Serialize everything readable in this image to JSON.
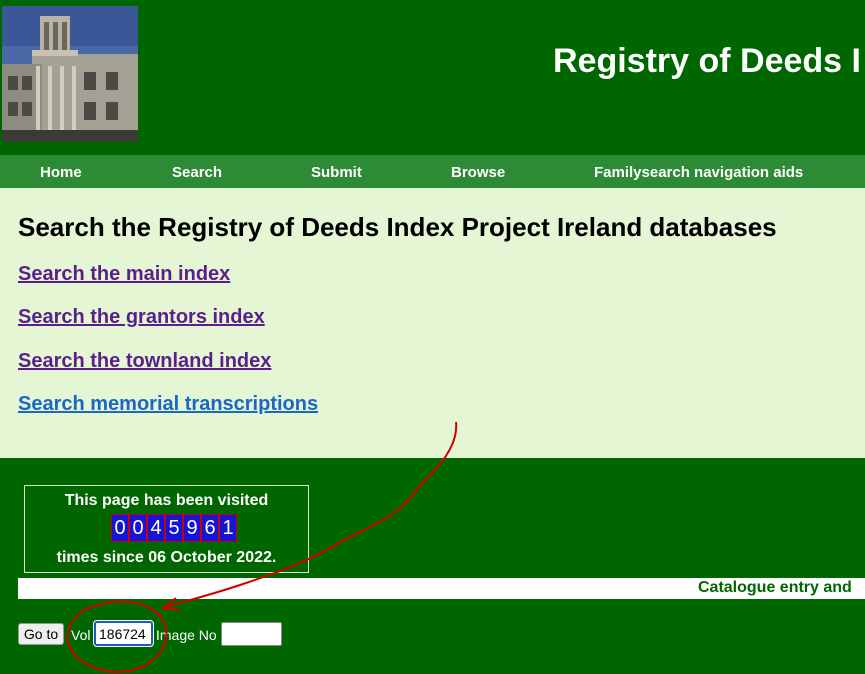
{
  "header": {
    "title": "Registry of Deeds I"
  },
  "nav": {
    "items": [
      {
        "label": "Home"
      },
      {
        "label": "Search"
      },
      {
        "label": "Submit"
      },
      {
        "label": "Browse"
      },
      {
        "label": "Familysearch navigation aids"
      }
    ]
  },
  "main": {
    "heading": "Search the Registry of Deeds Index Project Ireland databases",
    "links": [
      {
        "label": "Search the main index",
        "color": "#5b1f8c"
      },
      {
        "label": "Search the grantors index",
        "color": "#5b1f8c"
      },
      {
        "label": "Search the townland index",
        "color": "#5b1f8c"
      },
      {
        "label": "Search memorial transcriptions",
        "color": "#1a66c9"
      }
    ]
  },
  "counter": {
    "line1": "This page has been visited",
    "digits": [
      "0",
      "0",
      "4",
      "5",
      "9",
      "6",
      "1"
    ],
    "line3": "times since 06 October 2022."
  },
  "ticker": {
    "text": "Catalogue entry and"
  },
  "goto": {
    "button_label": "Go to",
    "vol_label": "Vol",
    "vol_value": "186724",
    "image_label": "Image No",
    "image_value": ""
  },
  "colors": {
    "page_bg": "#006600",
    "nav_bg": "#2d8a35",
    "content_bg": "#e4f6d3",
    "annotation": "#d40000"
  }
}
